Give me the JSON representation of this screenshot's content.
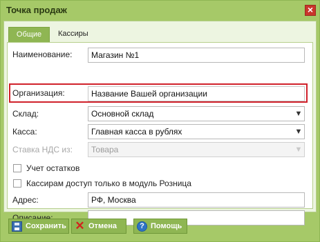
{
  "window": {
    "title": "Точка продаж",
    "close_glyph": "×"
  },
  "tabs": [
    {
      "label": "Общие",
      "active": true
    },
    {
      "label": "Кассиры",
      "active": false
    }
  ],
  "form": {
    "name": {
      "label": "Наименование:",
      "value": "Магазин №1"
    },
    "organization": {
      "label": "Организация:",
      "value": "Название Вашей организации"
    },
    "warehouse": {
      "label": "Склад:",
      "value": "Основной склад"
    },
    "cashbox": {
      "label": "Касса:",
      "value": "Главная касса в рублях"
    },
    "vat_rate": {
      "label": "Ставка НДС из:",
      "value": "Товара",
      "disabled": true
    },
    "stock_accounting": {
      "label": "Учет остатков",
      "checked": false
    },
    "cashiers_retail_only": {
      "label": "Кассирам доступ только в модуль Розница",
      "checked": false
    },
    "address": {
      "label": "Адрес:",
      "value": "РФ, Москва"
    },
    "description": {
      "label": "Описание:",
      "value": ""
    }
  },
  "buttons": {
    "save": {
      "label": "Сохранить",
      "icon": "floppy-disk-icon"
    },
    "cancel": {
      "label": "Отмена",
      "icon": "red-x-icon"
    },
    "help": {
      "label": "Помощь",
      "icon": "question-icon"
    }
  },
  "colors": {
    "accent": "#8fb653",
    "highlight": "#d0202a"
  }
}
